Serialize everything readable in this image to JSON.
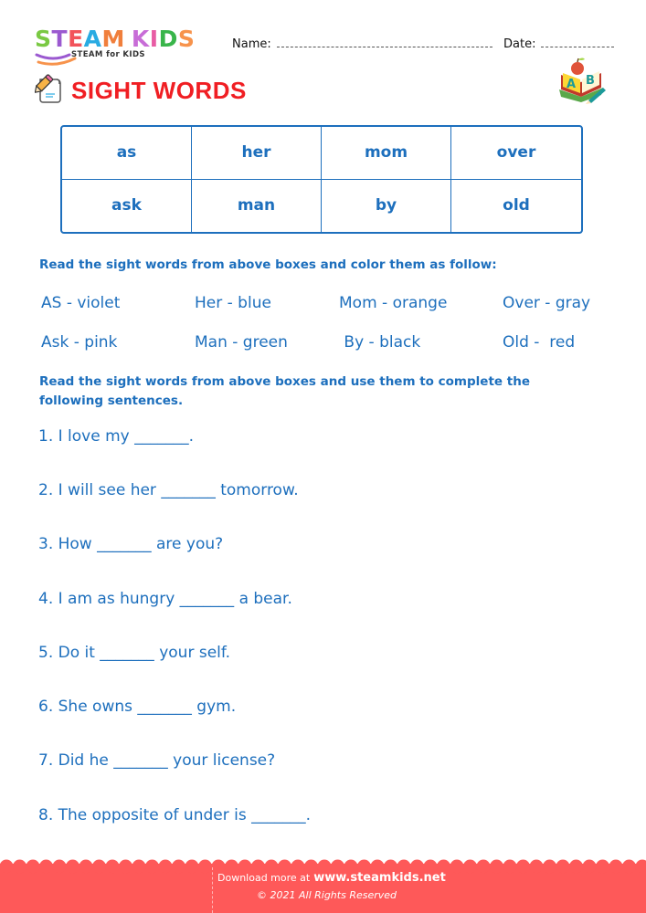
{
  "header": {
    "logo": {
      "letters": [
        {
          "char": "S",
          "color": "#7ac943"
        },
        {
          "char": "T",
          "color": "#9b59d0"
        },
        {
          "char": "E",
          "color": "#f2545b"
        },
        {
          "char": "A",
          "color": "#29abe2"
        },
        {
          "char": "M",
          "color": "#f07f3c"
        },
        {
          "char": " ",
          "color": "#ffffff"
        },
        {
          "char": "K",
          "color": "#c86dd7"
        },
        {
          "char": "I",
          "color": "#e85ca4"
        },
        {
          "char": "D",
          "color": "#39b54a"
        },
        {
          "char": "S",
          "color": "#f7934c"
        }
      ],
      "tagline": "STEAM for KIDS"
    },
    "name_label": "Name:",
    "date_label": "Date:",
    "title": "SIGHT WORDS",
    "title_color": "#f01e23"
  },
  "word_table": {
    "rows": [
      [
        "as",
        "her",
        "mom",
        "over"
      ],
      [
        "ask",
        "man",
        "by",
        "old"
      ]
    ]
  },
  "instructions": {
    "color_task": "Read the sight words from above boxes and color them as follow:",
    "sentence_task": "Read the sight words from above boxes and use them to complete the following sentences."
  },
  "color_key": [
    [
      "AS - violet",
      "Her - blue",
      "Mom - orange",
      "Over - gray"
    ],
    [
      "Ask - pink",
      "Man - green",
      " By - black",
      "Old -  red"
    ]
  ],
  "sentences": [
    "1. I love my _______.",
    "2. I will see her _______ tomorrow.",
    "3. How _______ are you?",
    "4. I am as hungry _______ a bear.",
    "5. Do it _______ your self.",
    "6. She owns _______ gym.",
    "7. Did he _______ your license?",
    "8. The opposite of under is _______."
  ],
  "footer": {
    "download_prefix": "Download more at",
    "website": "www.steamkids.net",
    "copyright": "©  2021 All Rights Reserved",
    "color": "#fe5959"
  },
  "theme": {
    "text_blue": "#1d6fbd"
  }
}
